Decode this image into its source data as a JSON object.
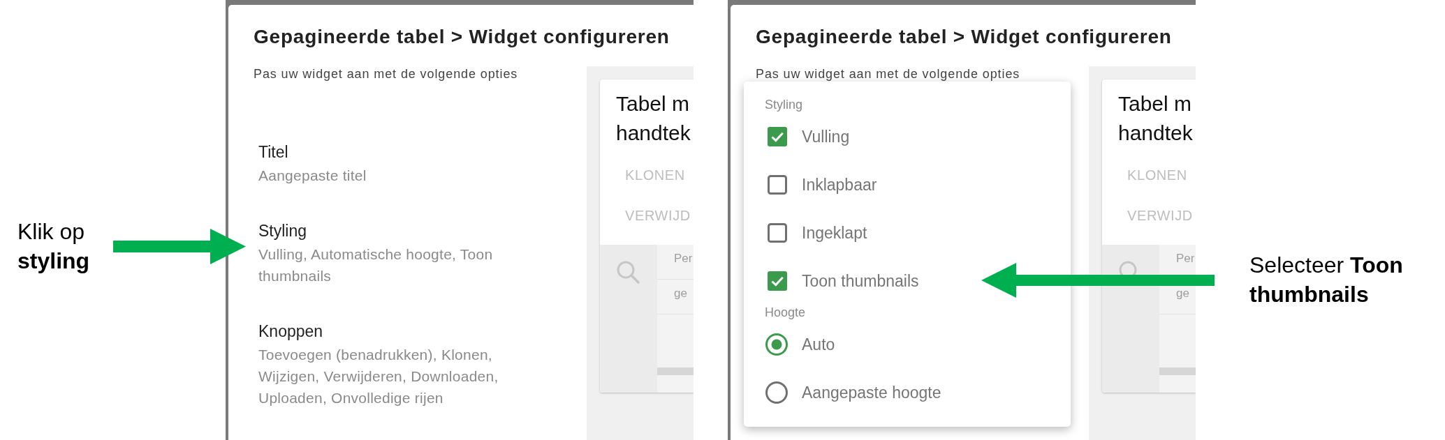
{
  "left_callout": {
    "text": "Klik op **styling**"
  },
  "screenshots": [
    {
      "title": "Gepagineerde tabel > Widget configureren",
      "subtitle": "Pas uw widget aan met de volgende opties",
      "settings": [
        {
          "title": "Titel",
          "summary": "Aangepaste titel"
        },
        {
          "title": "Styling",
          "summary": "Vulling, Automatische hoogte, Toon thumbnails"
        },
        {
          "title": "Knoppen",
          "summary": "Toevoegen (benadrukken), Klonen, Wijzigen, Verwijderen, Downloaden, Uploaden, Onvolledige rijen"
        }
      ],
      "preview": {
        "title_lines": [
          "Tabel m",
          "handtek"
        ],
        "buttons": [
          "KLONEN",
          "VERWIJD"
        ],
        "cells": [
          "Per",
          "ge"
        ]
      }
    },
    {
      "title": "Gepagineerde tabel > Widget configureren",
      "subtitle": "Pas uw widget aan met de volgende opties",
      "preview": {
        "title_lines": [
          "Tabel m",
          "handtek"
        ],
        "buttons": [
          "KLONEN",
          "VERWIJD"
        ],
        "cells": [
          "Per",
          "ge"
        ]
      },
      "dropdown": {
        "groups": [
          {
            "label": "Styling",
            "kind": "checkbox",
            "options": [
              {
                "label": "Vulling",
                "checked": true
              },
              {
                "label": "Inklapbaar",
                "checked": false
              },
              {
                "label": "Ingeklapt",
                "checked": false
              },
              {
                "label": "Toon thumbnails",
                "checked": true
              }
            ]
          },
          {
            "label": "Hoogte",
            "kind": "radio",
            "options": [
              {
                "label": "Auto",
                "selected": true
              },
              {
                "label": "Aangepaste hoogte",
                "selected": false
              }
            ]
          }
        ]
      }
    }
  ],
  "right_callout": {
    "text": "Selecteer **Toon thumbnails**"
  }
}
